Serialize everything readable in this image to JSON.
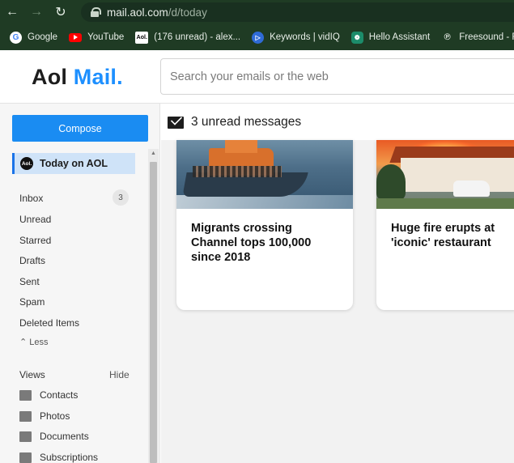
{
  "browser": {
    "url_host": "mail.aol.com",
    "url_path": "/d/today",
    "bookmarks": [
      {
        "label": "Google",
        "icon": "google-icon"
      },
      {
        "label": "YouTube",
        "icon": "youtube-icon"
      },
      {
        "label": "(176 unread) - alex...",
        "icon": "aol-icon"
      },
      {
        "label": "Keywords | vidIQ",
        "icon": "vidiq-icon"
      },
      {
        "label": "Hello Assistant",
        "icon": "chatgpt-icon"
      },
      {
        "label": "Freesound - Frees",
        "icon": "freesound-icon"
      }
    ]
  },
  "header": {
    "logo_aol": "Aol",
    "logo_mail": "Mail.",
    "search_placeholder": "Search your emails or the web"
  },
  "sidebar": {
    "compose_label": "Compose",
    "today_label": "Today on AOL",
    "today_icon_text": "Aol.",
    "folders": [
      {
        "label": "Inbox",
        "count": "3"
      },
      {
        "label": "Unread"
      },
      {
        "label": "Starred"
      },
      {
        "label": "Drafts"
      },
      {
        "label": "Sent"
      },
      {
        "label": "Spam"
      },
      {
        "label": "Deleted Items"
      }
    ],
    "less_label": "Less",
    "views_label": "Views",
    "views_hide": "Hide",
    "views": [
      {
        "label": "Contacts",
        "icon": "contacts-icon"
      },
      {
        "label": "Photos",
        "icon": "photos-icon"
      },
      {
        "label": "Documents",
        "icon": "documents-icon"
      },
      {
        "label": "Subscriptions",
        "icon": "subscriptions-icon"
      }
    ]
  },
  "main": {
    "unread_text": "3 unread messages",
    "cards": [
      {
        "headline": "Migrants crossing Channel tops 100,000 since 2018"
      },
      {
        "headline": "Huge fire erupts at 'iconic' restaurant"
      }
    ]
  },
  "colors": {
    "accent": "#1a8cf2",
    "logo_mail": "#1e90ff",
    "chrome": "#1f3b24"
  }
}
